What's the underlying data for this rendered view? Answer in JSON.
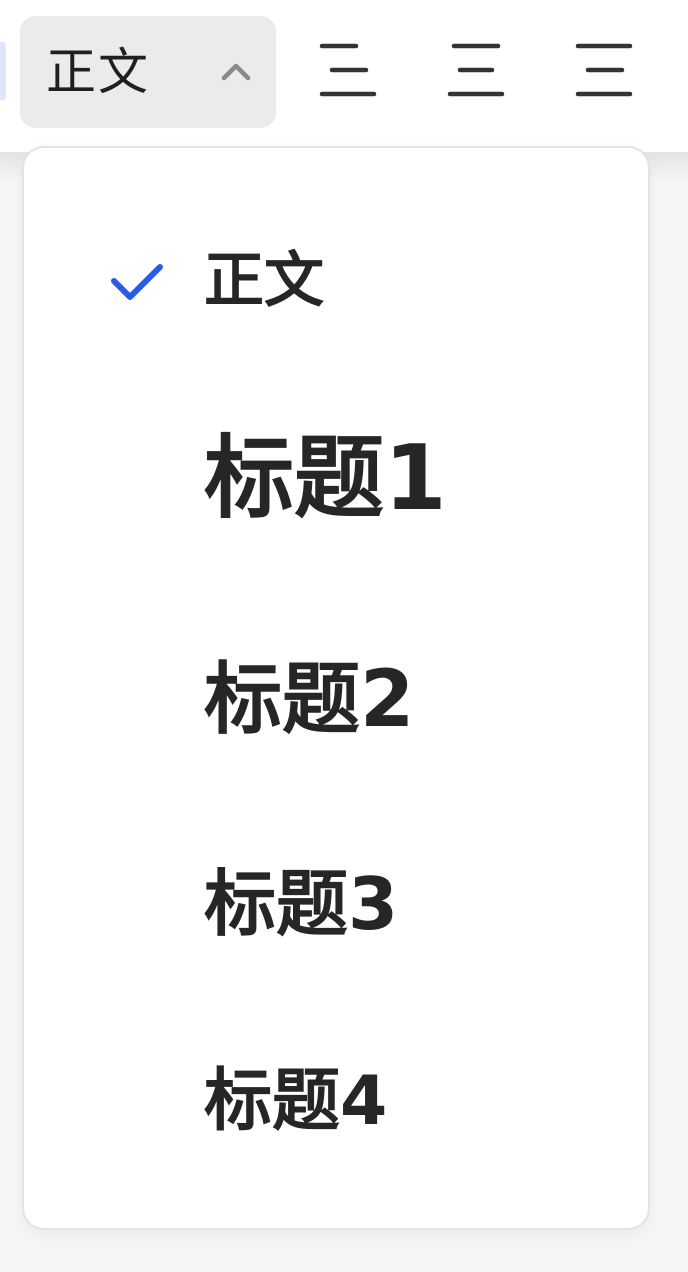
{
  "toolbar": {
    "style_select": {
      "current": "正文",
      "expanded": true
    },
    "align_buttons": [
      {
        "name": "align-left-icon"
      },
      {
        "name": "align-center-icon"
      },
      {
        "name": "align-right-icon"
      }
    ]
  },
  "menu": {
    "items": [
      {
        "label": "正文",
        "selected": true
      },
      {
        "label": "标题1",
        "selected": false
      },
      {
        "label": "标题2",
        "selected": false
      },
      {
        "label": "标题3",
        "selected": false
      },
      {
        "label": "标题4",
        "selected": false
      }
    ],
    "check_color": "#2b5be6"
  },
  "colors": {
    "text": "#262626",
    "select_bg": "#ebebeb",
    "accent": "#2b5be6"
  }
}
